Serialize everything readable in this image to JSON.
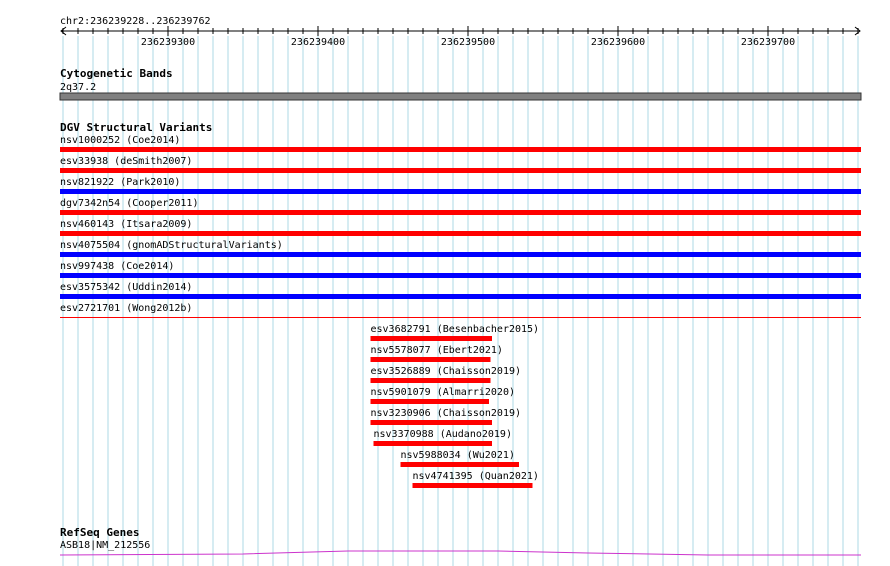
{
  "ruler": {
    "range_label": "chr2:236239228..236239762",
    "start": 236239228,
    "end": 236239762,
    "ticks": [
      {
        "pos": 236239300,
        "label": "236239300"
      },
      {
        "pos": 236239400,
        "label": "236239400"
      },
      {
        "pos": 236239500,
        "label": "236239500"
      },
      {
        "pos": 236239600,
        "label": "236239600"
      },
      {
        "pos": 236239700,
        "label": "236239700"
      }
    ],
    "minor_step": 10
  },
  "colors": {
    "grid": "#add8e6",
    "loss": "#ff0000",
    "gain": "#0000ff",
    "band": "#808080",
    "gene": "#cc33cc"
  },
  "tracks": {
    "cytoband": {
      "title": "Cytogenetic Bands",
      "feature": {
        "label": "2q37.2",
        "start": 236239228,
        "end": 236239762,
        "color": "#808080"
      }
    },
    "dgv": {
      "title": "DGV Structural Variants",
      "features": [
        {
          "label": "nsv1000252 (Coe2014)",
          "start": 236239228,
          "end": 236239762,
          "color": "#ff0000",
          "row": 0
        },
        {
          "label": "esv33938 (deSmith2007)",
          "start": 236239228,
          "end": 236239762,
          "color": "#ff0000",
          "row": 1
        },
        {
          "label": "nsv821922 (Park2010)",
          "start": 236239228,
          "end": 236239762,
          "color": "#0000ff",
          "row": 2
        },
        {
          "label": "dgv7342n54 (Cooper2011)",
          "start": 236239228,
          "end": 236239762,
          "color": "#ff0000",
          "row": 3
        },
        {
          "label": "nsv460143 (Itsara2009)",
          "start": 236239228,
          "end": 236239762,
          "color": "#ff0000",
          "row": 4
        },
        {
          "label": "nsv4075504 (gnomADStructuralVariants)",
          "start": 236239228,
          "end": 236239762,
          "color": "#0000ff",
          "row": 5
        },
        {
          "label": "nsv997438 (Coe2014)",
          "start": 236239228,
          "end": 236239762,
          "color": "#0000ff",
          "row": 6
        },
        {
          "label": "esv3575342 (Uddin2014)",
          "start": 236239228,
          "end": 236239762,
          "color": "#0000ff",
          "row": 7
        },
        {
          "label": "esv2721701 (Wong2012b)",
          "start": 236239228,
          "end": 236239762,
          "color": "#ff0000",
          "row": 8,
          "thin": true
        },
        {
          "label": "esv3682791 (Besenbacher2015)",
          "start": 236239435,
          "end": 236239516,
          "color": "#ff0000",
          "row": 9
        },
        {
          "label": "nsv5578077 (Ebert2021)",
          "start": 236239435,
          "end": 236239515,
          "color": "#ff0000",
          "row": 10
        },
        {
          "label": "esv3526889 (Chaisson2019)",
          "start": 236239435,
          "end": 236239515,
          "color": "#ff0000",
          "row": 11
        },
        {
          "label": "nsv5901079 (Almarri2020)",
          "start": 236239435,
          "end": 236239514,
          "color": "#ff0000",
          "row": 12
        },
        {
          "label": "nsv3230906 (Chaisson2019)",
          "start": 236239435,
          "end": 236239516,
          "color": "#ff0000",
          "row": 13
        },
        {
          "label": "nsv3370988 (Audano2019)",
          "start": 236239437,
          "end": 236239516,
          "color": "#ff0000",
          "row": 14
        },
        {
          "label": "nsv5988034 (Wu2021)",
          "start": 236239455,
          "end": 236239534,
          "color": "#ff0000",
          "row": 15
        },
        {
          "label": "nsv4741395 (Quan2021)",
          "start": 236239463,
          "end": 236239543,
          "color": "#ff0000",
          "row": 16
        }
      ]
    },
    "refseq": {
      "title": "RefSeq Genes",
      "feature": {
        "label": "ASB18|NM_212556",
        "start": 236239228,
        "end": 236239762,
        "color": "#cc33cc"
      }
    }
  }
}
